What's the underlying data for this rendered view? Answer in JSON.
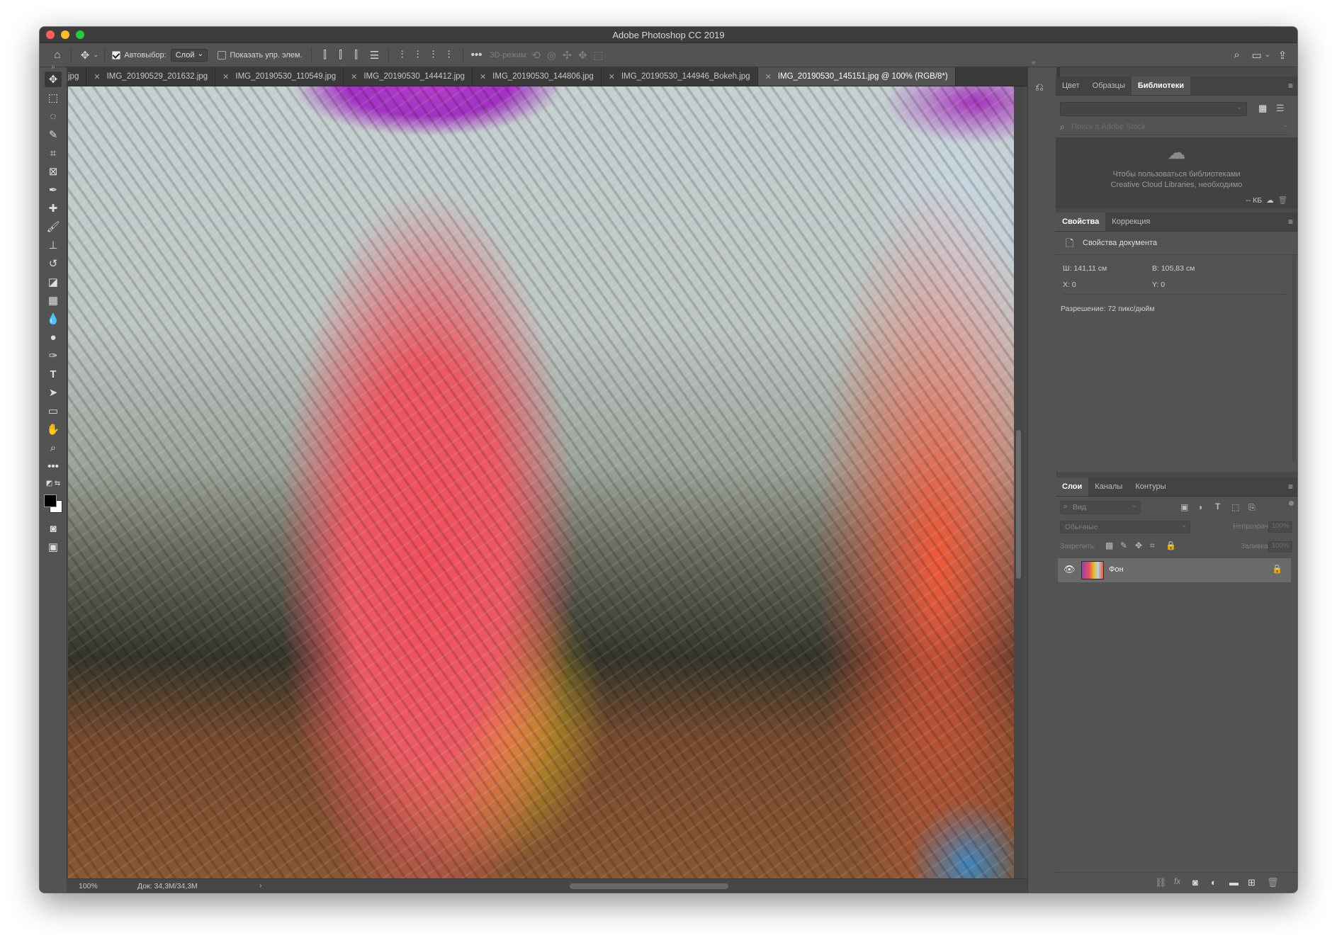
{
  "app": {
    "title": "Adobe Photoshop CC 2019"
  },
  "options_bar": {
    "auto_select_label": "Автовыбор:",
    "auto_select_value": "Слой",
    "show_transform_label": "Показать упр. элем.",
    "mode_3d_label": "3D-режим:"
  },
  "tabs": [
    {
      "label": "jpg",
      "active": false,
      "closable": false
    },
    {
      "label": "IMG_20190529_201632.jpg",
      "active": false,
      "closable": true
    },
    {
      "label": "IMG_20190530_110549.jpg",
      "active": false,
      "closable": true
    },
    {
      "label": "IMG_20190530_144412.jpg",
      "active": false,
      "closable": true
    },
    {
      "label": "IMG_20190530_144806.jpg",
      "active": false,
      "closable": true
    },
    {
      "label": "IMG_20190530_144946_Bokeh.jpg",
      "active": false,
      "closable": true
    },
    {
      "label": "IMG_20190530_145151.jpg @ 100% (RGB/8*)",
      "active": true,
      "closable": true
    }
  ],
  "status_bar": {
    "zoom": "100%",
    "doc": "Док: 34,3M/34,3M"
  },
  "libraries_panel": {
    "tabs": [
      "Цвет",
      "Образцы",
      "Библиотеки"
    ],
    "active_tab": "Библиотеки",
    "search_placeholder": "Поиск в Adobe Stock",
    "message_line1": "Чтобы пользоваться библиотеками",
    "message_line2": "Creative Cloud Libraries, необходимо",
    "size_label": "-- КБ"
  },
  "properties_panel": {
    "tabs": [
      "Свойства",
      "Коррекция"
    ],
    "active_tab": "Свойства",
    "doc_props_label": "Свойства документа",
    "width": "Ш:  141,11 см",
    "height": "В:  105,83 см",
    "x": "X:  0",
    "y": "Y:  0",
    "resolution": "Разрешение: 72 пикс/дюйм"
  },
  "layers_panel": {
    "tabs": [
      "Слои",
      "Каналы",
      "Контуры"
    ],
    "active_tab": "Слои",
    "filter_placeholder": "Вид",
    "blend_mode": "Обычные",
    "opacity_label": "Непрозрачность:",
    "opacity_value": "100%",
    "lock_label": "Закрепить:",
    "fill_label": "Заливка:",
    "fill_value": "100%",
    "layers": [
      {
        "name": "Фон",
        "visible": true,
        "locked": true
      }
    ]
  }
}
